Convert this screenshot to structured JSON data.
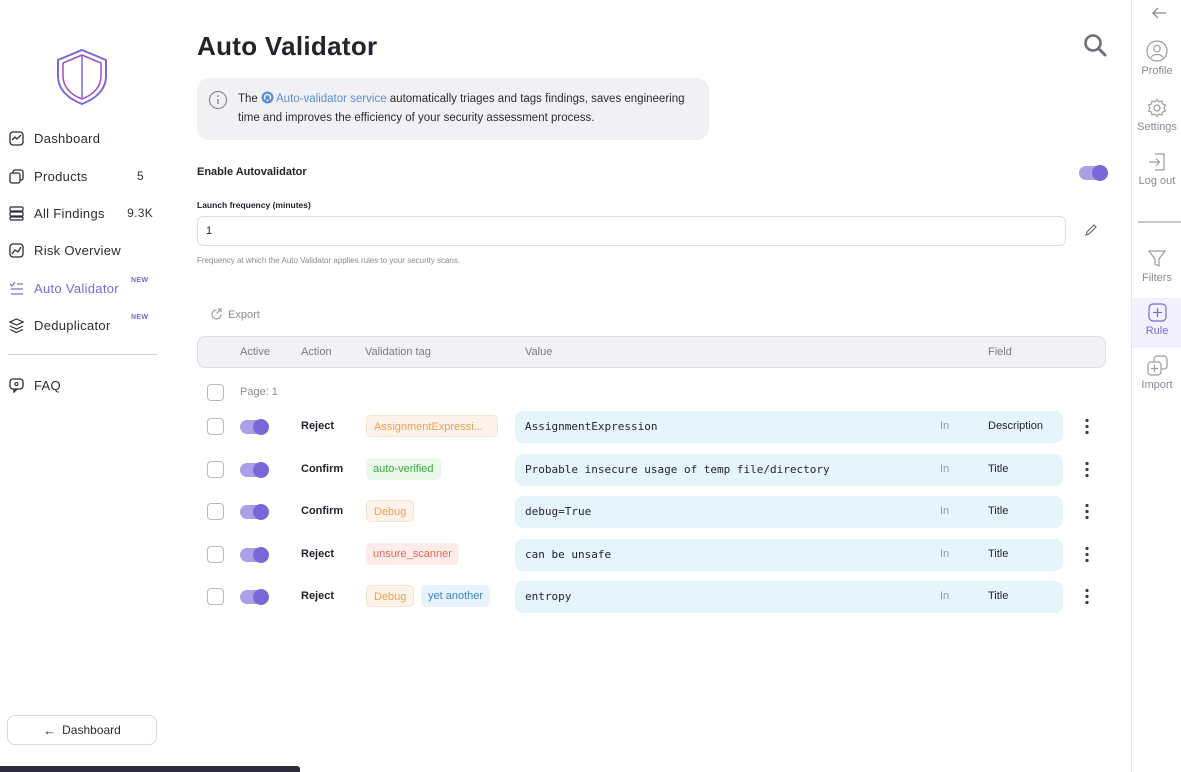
{
  "sidebar": {
    "items": [
      {
        "label": "Dashboard",
        "icon": "dashboard-icon"
      },
      {
        "label": "Products",
        "count": "5",
        "icon": "products-icon"
      },
      {
        "label": "All Findings",
        "count": "9.3K",
        "icon": "findings-icon"
      },
      {
        "label": "Risk Overview",
        "icon": "risk-overview-icon"
      },
      {
        "label": "Auto Validator",
        "badge": "NEW",
        "icon": "auto-validator-icon",
        "active": true
      },
      {
        "label": "Deduplicator",
        "badge": "NEW",
        "icon": "deduplicator-icon"
      },
      {
        "label": "FAQ",
        "icon": "faq-icon"
      }
    ],
    "back_button": "Dashboard"
  },
  "main": {
    "title": "Auto Validator",
    "info": {
      "prefix": "The ",
      "link": "Auto-validator service",
      "suffix": " automatically triages and tags findings, saves engineering time and improves the efficiency of your security assessment process."
    },
    "enable_label": "Enable Autovalidator",
    "enable_on": true,
    "freq_label": "Launch frequency (minutes)",
    "freq_value": "1",
    "freq_help": "Frequency at which the Auto Validator applies rules to your security scans.",
    "export_label": "Export"
  },
  "table": {
    "headers": [
      "Active",
      "Action",
      "Validation tag",
      "Value",
      "Field"
    ],
    "page_label": "Page: 1",
    "rows": [
      {
        "active": true,
        "action": "Reject",
        "tags": [
          {
            "text": "AssignmentExpressi...",
            "style": "orange"
          }
        ],
        "value": "AssignmentExpression",
        "op": "In",
        "field": "Description"
      },
      {
        "active": true,
        "action": "Confirm",
        "tags": [
          {
            "text": "auto-verified",
            "style": "green"
          }
        ],
        "value": "Probable insecure usage of temp file/directory",
        "op": "In",
        "field": "Title"
      },
      {
        "active": true,
        "action": "Confirm",
        "tags": [
          {
            "text": "Debug",
            "style": "orange"
          }
        ],
        "value": "debug=True",
        "op": "In",
        "field": "Title"
      },
      {
        "active": true,
        "action": "Reject",
        "tags": [
          {
            "text": "unsure_scanner",
            "style": "red"
          }
        ],
        "value": "can be unsafe",
        "op": "In",
        "field": "Title"
      },
      {
        "active": true,
        "action": "Reject",
        "tags": [
          {
            "text": "Debug",
            "style": "orange"
          },
          {
            "text": "yet another",
            "style": "blue"
          }
        ],
        "value": "entropy",
        "op": "In",
        "field": "Title"
      }
    ]
  },
  "rail": {
    "items": [
      {
        "label": "Profile",
        "icon": "profile-icon"
      },
      {
        "label": "Settings",
        "icon": "settings-icon"
      },
      {
        "label": "Log out",
        "icon": "logout-icon"
      },
      {
        "label": "Filters",
        "icon": "filter-icon"
      },
      {
        "label": "Rule",
        "icon": "add-rule-icon",
        "active": true
      },
      {
        "label": "Import",
        "icon": "import-icon"
      }
    ]
  },
  "colors": {
    "accent": "#7b68d8",
    "link": "#5b8fd8",
    "value_bg": "#e6f5fb"
  }
}
